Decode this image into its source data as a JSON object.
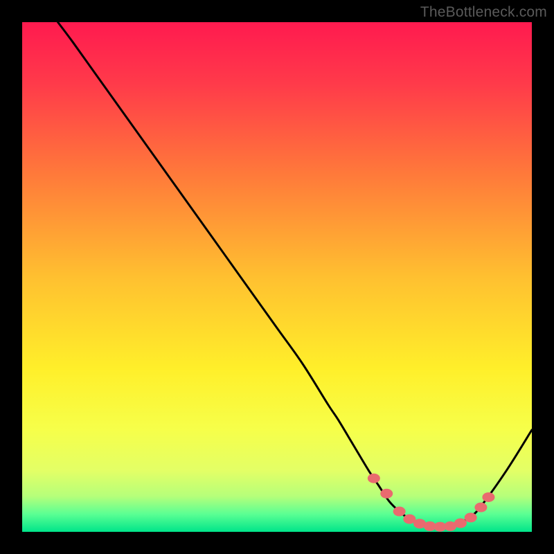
{
  "watermark": "TheBottleneck.com",
  "chart_data": {
    "type": "line",
    "title": "",
    "xlabel": "",
    "ylabel": "",
    "xlim": [
      0,
      100
    ],
    "ylim": [
      0,
      100
    ],
    "series": [
      {
        "name": "bottleneck-curve",
        "x": [
          7,
          10,
          15,
          20,
          25,
          30,
          35,
          40,
          45,
          50,
          55,
          60,
          62,
          65,
          68,
          70,
          72,
          74,
          76,
          78,
          80,
          82,
          84,
          86,
          88,
          90,
          95,
          100
        ],
        "y": [
          100,
          96,
          89,
          82,
          75,
          68,
          61,
          54,
          47,
          40,
          33,
          25,
          22,
          17,
          12,
          9,
          6,
          4,
          2.5,
          1.5,
          1,
          1,
          1.2,
          1.8,
          3,
          5,
          12,
          20
        ]
      }
    ],
    "markers": {
      "name": "optimal-zone-markers",
      "x": [
        69,
        71.5,
        74,
        76,
        78,
        80,
        82,
        84,
        86,
        88,
        90,
        91.5
      ],
      "y": [
        10.5,
        7.5,
        4,
        2.5,
        1.6,
        1.1,
        1.0,
        1.1,
        1.7,
        2.8,
        4.8,
        6.8
      ]
    },
    "gradient_stops": [
      {
        "offset": 0.0,
        "color": "#ff1a4f"
      },
      {
        "offset": 0.12,
        "color": "#ff3a4a"
      },
      {
        "offset": 0.3,
        "color": "#ff7a3a"
      },
      {
        "offset": 0.5,
        "color": "#ffc030"
      },
      {
        "offset": 0.68,
        "color": "#ffef2a"
      },
      {
        "offset": 0.8,
        "color": "#f6ff4a"
      },
      {
        "offset": 0.88,
        "color": "#e3ff66"
      },
      {
        "offset": 0.93,
        "color": "#b6ff7a"
      },
      {
        "offset": 0.965,
        "color": "#5bff93"
      },
      {
        "offset": 1.0,
        "color": "#00e58a"
      }
    ],
    "marker_color": "#e96a6f",
    "curve_color": "#000000"
  }
}
